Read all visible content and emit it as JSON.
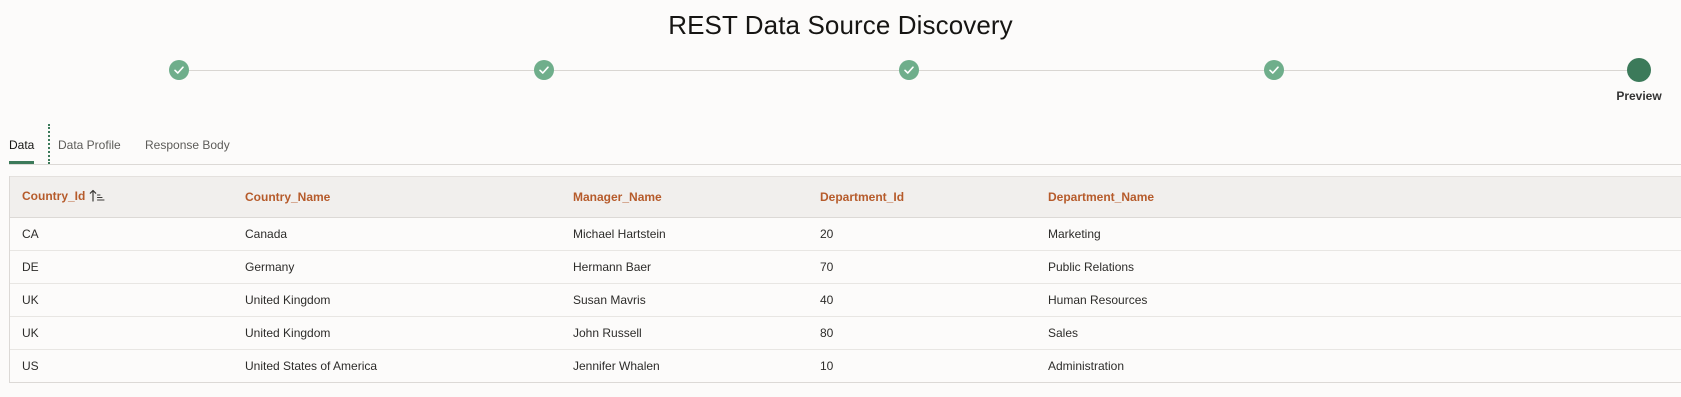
{
  "page": {
    "title": "REST Data Source Discovery"
  },
  "train": {
    "steps": [
      {
        "state": "complete",
        "icon": "checkmark-icon"
      },
      {
        "state": "complete",
        "icon": "checkmark-icon"
      },
      {
        "state": "complete",
        "icon": "checkmark-icon"
      },
      {
        "state": "complete",
        "icon": "checkmark-icon"
      },
      {
        "state": "current",
        "label": "Preview"
      }
    ],
    "colors": {
      "complete": "#6fae8b",
      "current": "#3c7a5a"
    }
  },
  "tabs": [
    {
      "label": "Data",
      "active": true
    },
    {
      "label": "Data Profile",
      "active": false
    },
    {
      "label": "Response Body",
      "active": false
    }
  ],
  "table": {
    "columns": [
      {
        "label": "Country_Id",
        "sort": "ascending",
        "sort_icon": "sort-ascending-icon"
      },
      {
        "label": "Country_Name"
      },
      {
        "label": "Manager_Name"
      },
      {
        "label": "Department_Id"
      },
      {
        "label": "Department_Name"
      }
    ],
    "rows": [
      [
        "CA",
        "Canada",
        "Michael Hartstein",
        "20",
        "Marketing"
      ],
      [
        "DE",
        "Germany",
        "Hermann Baer",
        "70",
        "Public Relations"
      ],
      [
        "UK",
        "United Kingdom",
        "Susan Mavris",
        "40",
        "Human Resources"
      ],
      [
        "UK",
        "United Kingdom",
        "John Russell",
        "80",
        "Sales"
      ],
      [
        "US",
        "United States of America",
        "Jennifer Whalen",
        "10",
        "Administration"
      ]
    ],
    "header_color": "#b65b2b"
  }
}
